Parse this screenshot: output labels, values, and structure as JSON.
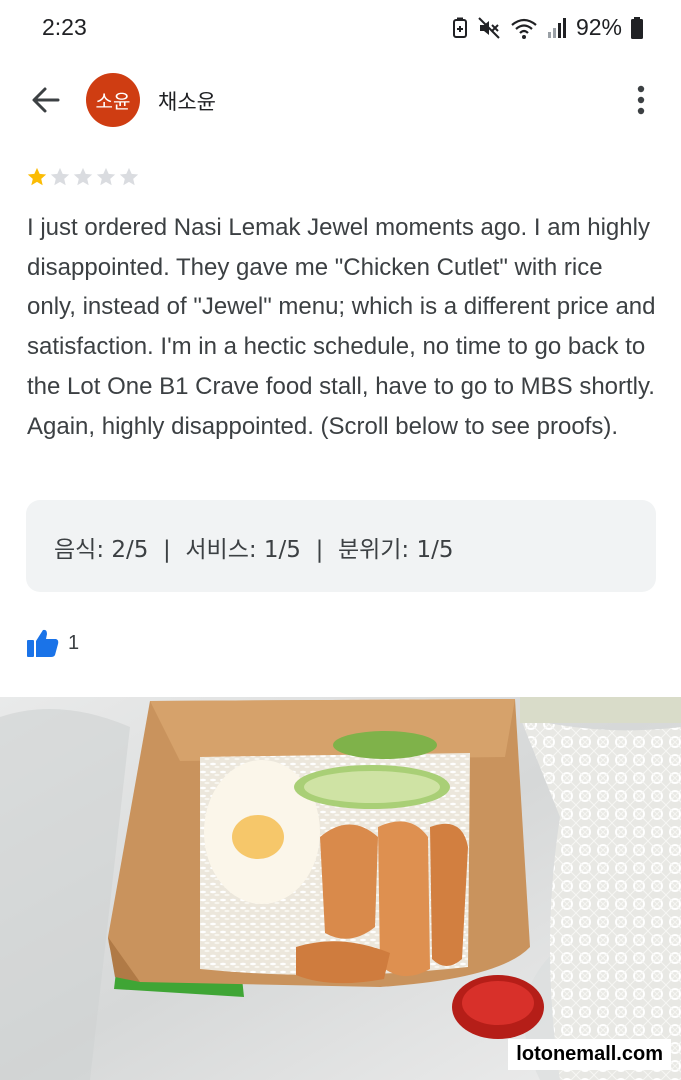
{
  "status_bar": {
    "time": "2:23",
    "battery": "92%",
    "icons": [
      "battery-saver-icon",
      "mute-icon",
      "wifi-icon",
      "signal-icon",
      "battery-icon"
    ]
  },
  "header": {
    "avatar_text": "소윤",
    "avatar_color": "#cf3d12",
    "user_name": "채소윤",
    "back_icon": "arrow-left-icon",
    "menu_icon": "more-vert-icon"
  },
  "review": {
    "rating": 1,
    "max_rating": 5,
    "star_color": "#fbbc04",
    "text": "I just ordered Nasi Lemak Jewel moments ago. I am highly disappointed. They gave me \"Chicken Cutlet\" with rice only, instead of \"Jewel\" menu; which is a different price and satisfaction. I'm in a hectic schedule, no time to go back to the Lot One B1 Crave food stall, have to go to MBS shortly. Again, highly disappointed. (Scroll below to see proofs)."
  },
  "ratings_summary": "음식: 2/5  |  서비스: 1/5  |  분위기: 1/5",
  "likes": {
    "count": "1",
    "icon": "thumbs-up-icon",
    "color": "#1a73e8"
  },
  "photo": {
    "watermark": "lotonemall.com"
  }
}
